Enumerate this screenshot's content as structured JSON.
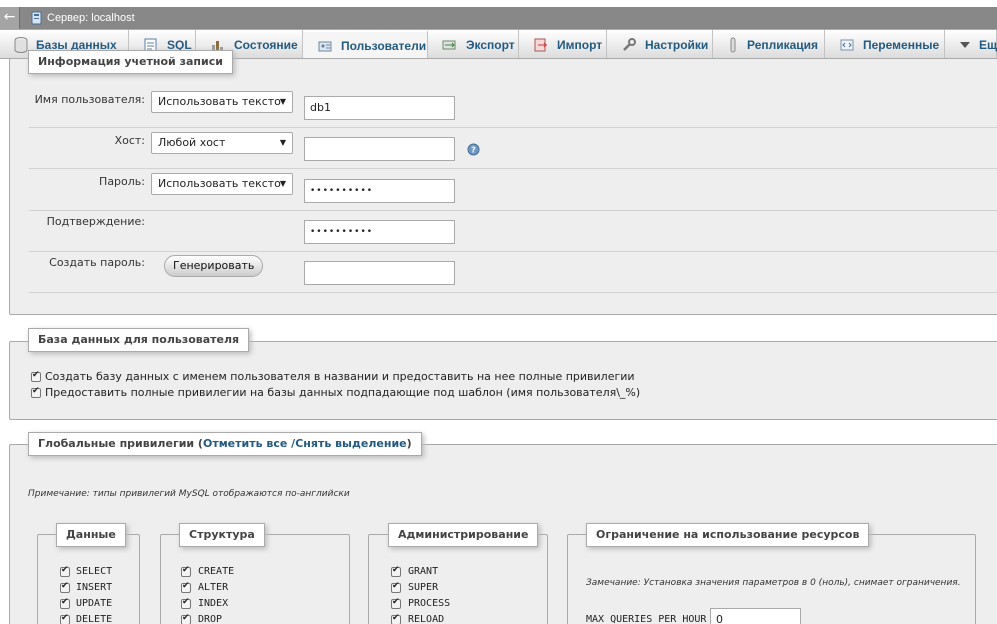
{
  "topbar": {
    "title": "Сервер: localhost",
    "back_icon": "back-arrow-icon",
    "server_icon": "server-icon"
  },
  "tabs": [
    {
      "label": "Базы данных",
      "icon": "database-icon"
    },
    {
      "label": "SQL",
      "icon": "sql-icon"
    },
    {
      "label": "Состояние",
      "icon": "status-icon"
    },
    {
      "label": "Пользователи",
      "icon": "users-icon",
      "active": true
    },
    {
      "label": "Экспорт",
      "icon": "export-icon"
    },
    {
      "label": "Импорт",
      "icon": "import-icon"
    },
    {
      "label": "Настройки",
      "icon": "wrench-icon"
    },
    {
      "label": "Репликация",
      "icon": "replication-icon"
    },
    {
      "label": "Переменные",
      "icon": "variables-icon"
    },
    {
      "label": "Ещё",
      "icon": "chevron-down-icon"
    }
  ],
  "login": {
    "legend": "Информация учетной записи",
    "username_label": "Имя пользователя:",
    "username_mode": "Использовать тексто",
    "username_value": "db1",
    "host_label": "Хост:",
    "host_mode": "Любой хост",
    "host_value": "",
    "password_label": "Пароль:",
    "password_mode": "Использовать тексто",
    "password_mask": "••••••••••",
    "confirm_label": "Подтверждение:",
    "confirm_mask": "••••••••••",
    "generate_label": "Создать пароль:",
    "generate_button": "Генерировать",
    "generated_value": ""
  },
  "database": {
    "legend": "База данных для пользователя",
    "option1": "Создать базу данных с именем пользователя в названии и предоставить на нее полные привилегии",
    "option2": "Предоставить полные привилегии на базы данных подпадающие под шаблон (имя пользователя\\_%)"
  },
  "global": {
    "legend_prefix": "Глобальные привилегии (",
    "check_all": "Отметить все",
    "separator": " /",
    "uncheck_all": "Снять выделение",
    "legend_suffix": ")",
    "note": "Примечание: типы привилегий MySQL отображаются по-английски",
    "data_legend": "Данные",
    "data_privs": [
      "SELECT",
      "INSERT",
      "UPDATE",
      "DELETE"
    ],
    "structure_legend": "Структура",
    "structure_privs": [
      "CREATE",
      "ALTER",
      "INDEX",
      "DROP"
    ],
    "admin_legend": "Администрирование",
    "admin_privs": [
      "GRANT",
      "SUPER",
      "PROCESS",
      "RELOAD"
    ],
    "limits_legend": "Ограничение на использование ресурсов",
    "limits_note": "Замечание: Установка значения параметров в 0 (ноль), снимает ограничения.",
    "max_queries_label": "MAX QUERIES PER HOUR",
    "max_queries_value": "0"
  }
}
